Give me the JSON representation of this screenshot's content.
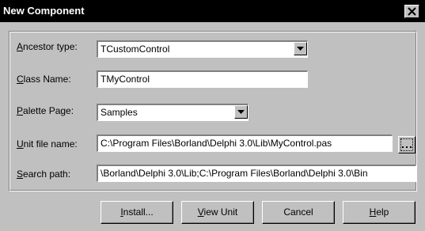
{
  "window": {
    "title": "New Component",
    "close_icon": "close-x-icon"
  },
  "form": {
    "ancestor_type": {
      "label_key": "A",
      "label_rest": "ncestor type:",
      "value": "TCustomControl"
    },
    "class_name": {
      "label_key": "C",
      "label_rest": "lass Name:",
      "value": "TMyControl"
    },
    "palette_page": {
      "label_key": "P",
      "label_rest": "alette Page:",
      "value": "Samples"
    },
    "unit_file_name": {
      "label_key": "U",
      "label_rest": "nit file name:",
      "value": "C:\\Program Files\\Borland\\Delphi 3.0\\Lib\\MyControl.pas",
      "browse_label": "..."
    },
    "search_path": {
      "label_key": "S",
      "label_rest": "earch path:",
      "value": "\\Borland\\Delphi 3.0\\Lib;C:\\Program Files\\Borland\\Delphi 3.0\\Bin"
    }
  },
  "buttons": {
    "install": {
      "key": "I",
      "rest": "nstall..."
    },
    "view_unit": {
      "key": "V",
      "rest": "iew Unit"
    },
    "cancel": {
      "label": "Cancel"
    },
    "help": {
      "key": "H",
      "rest": "elp"
    }
  }
}
